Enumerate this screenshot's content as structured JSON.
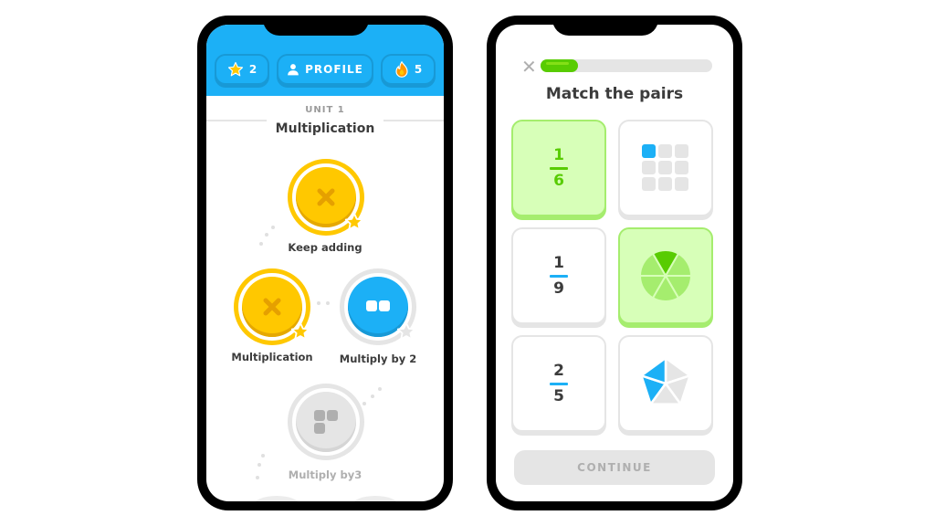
{
  "left_phone": {
    "topbar": {
      "gems": {
        "icon": "star-icon",
        "count": "2"
      },
      "profile": {
        "icon": "person-icon",
        "label": "PROFILE"
      },
      "streak": {
        "icon": "flame-icon",
        "count": "5"
      },
      "color": "#1cb0f6"
    },
    "unit": {
      "label": "UNIT 1",
      "title": "Multiplication"
    },
    "lessons": [
      {
        "label": "Keep adding",
        "status": "completed",
        "icon": "multiply-icon"
      },
      {
        "label": "Multiplication",
        "status": "completed",
        "icon": "multiply-icon"
      },
      {
        "label": "Multiply by 2",
        "status": "active",
        "icon": "two-squares-icon"
      },
      {
        "label": "Multiply  by3",
        "status": "locked",
        "icon": "three-squares-icon"
      }
    ]
  },
  "right_phone": {
    "close_icon": "close-icon",
    "progress": 0.22,
    "prompt": "Match the pairs",
    "cards": [
      {
        "type": "fraction",
        "numerator": "1",
        "denominator": "6",
        "selected": true
      },
      {
        "type": "grid",
        "filled": 1,
        "total": 9,
        "selected": false
      },
      {
        "type": "fraction",
        "numerator": "1",
        "denominator": "9",
        "selected": false
      },
      {
        "type": "pie",
        "filled": 1,
        "total": 6,
        "selected": true
      },
      {
        "type": "fraction",
        "numerator": "2",
        "denominator": "5",
        "selected": false
      },
      {
        "type": "pentagon",
        "filled": 2,
        "total": 5,
        "selected": false
      }
    ],
    "continue_label": "CONTINUE"
  },
  "colors": {
    "green": "#58cc02",
    "light_green": "#d7ffb8",
    "blue": "#1cb0f6",
    "gold": "#ffc800",
    "gray": "#e5e5e5"
  }
}
